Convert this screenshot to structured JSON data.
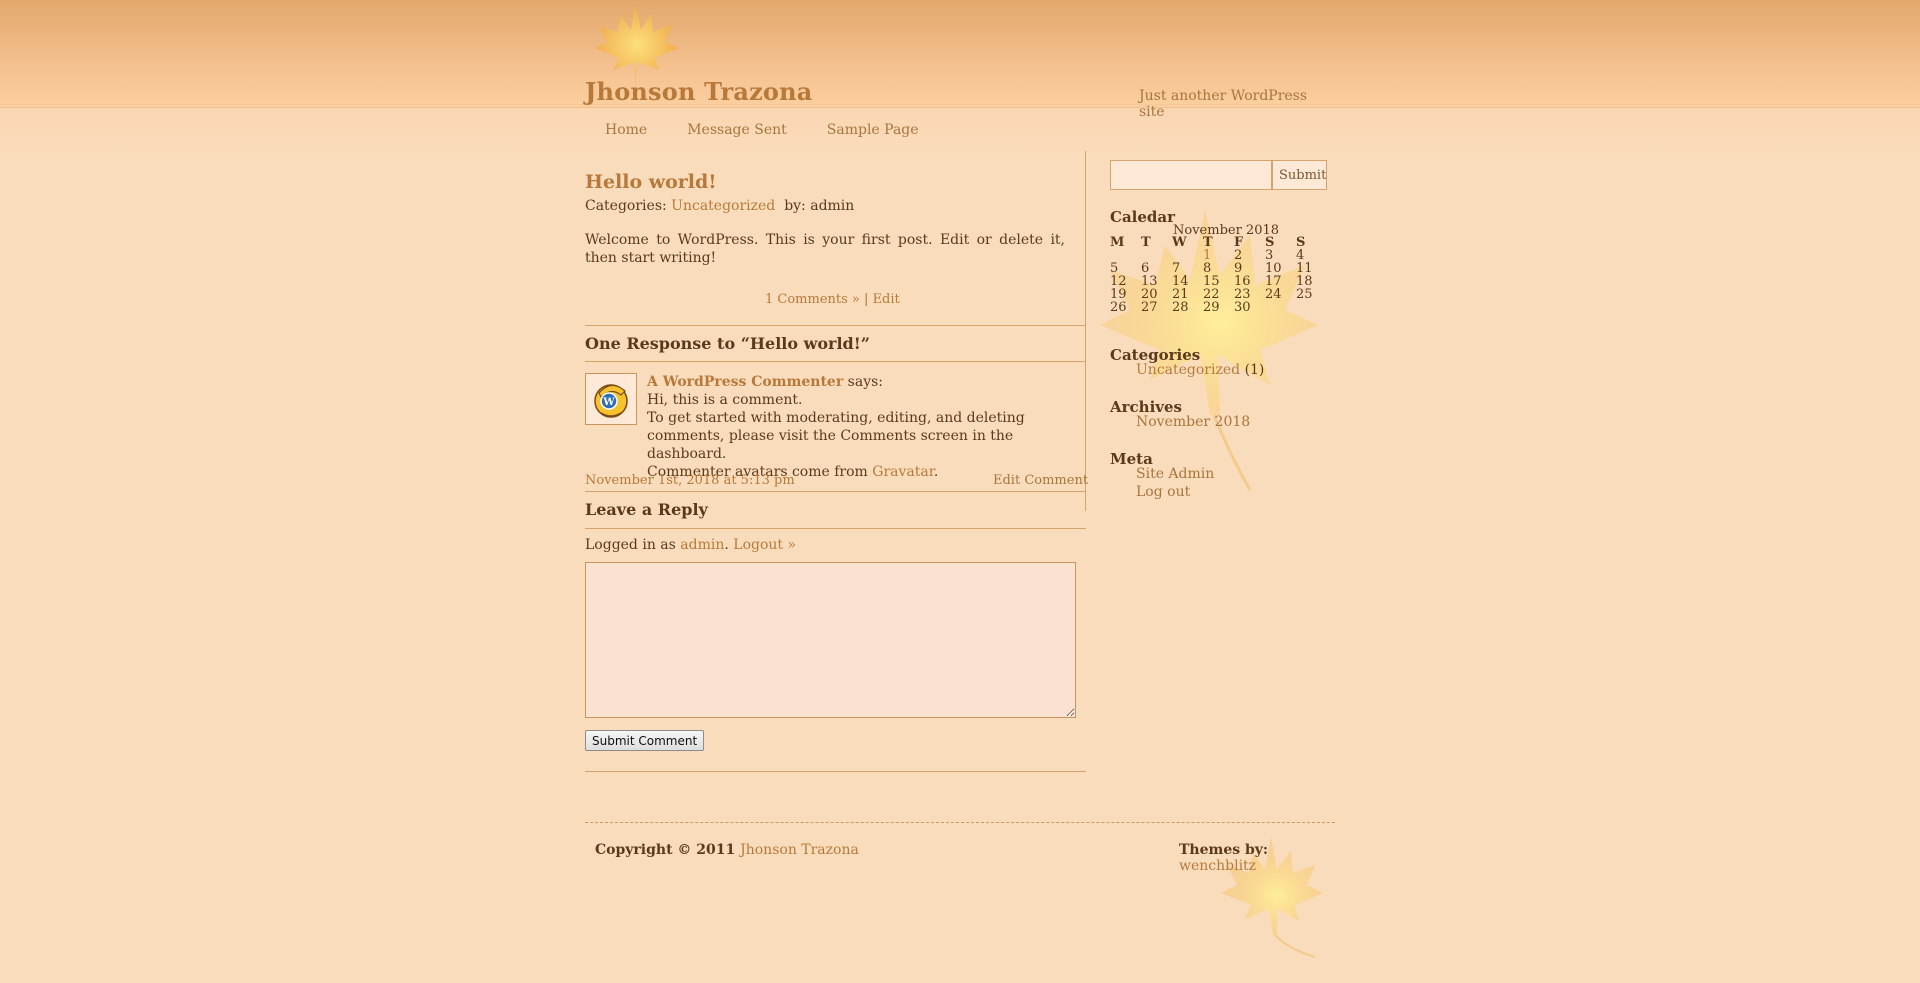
{
  "site": {
    "title": "Jhonson Trazona",
    "tagline": "Just another WordPress site"
  },
  "nav": [
    "Home",
    "Message Sent",
    "Sample Page"
  ],
  "post": {
    "title": "Hello world!",
    "categories_label": "Categories:",
    "category": "Uncategorized",
    "by_label": "by: admin",
    "body": "Welcome to WordPress. This is your first post. Edit or delete it, then start writing!",
    "comments_link": "1 Comments »",
    "separator": "|",
    "edit_link": "Edit"
  },
  "responses": {
    "title": "One Response to “Hello world!”",
    "comment": {
      "author": "A WordPress Commenter",
      "says": "says:",
      "line1": "Hi, this is a comment.",
      "line2": "To get started with moderating, editing, and deleting comments, please visit the Comments screen in the dashboard.",
      "line3_prefix": "Commenter avatars come from",
      "line3_link": "Gravatar",
      "line3_suffix": ".",
      "date": "November 1st, 2018 at 5:13 pm",
      "edit": "Edit Comment"
    }
  },
  "reply": {
    "title": "Leave a Reply",
    "logged_prefix": "Logged in as",
    "user": "admin",
    "logout": "Logout »",
    "textarea_value": "",
    "submit": "Submit Comment"
  },
  "sidebar": {
    "search_value": "",
    "search_button": "Submit",
    "calendar": {
      "heading": "Caledar",
      "caption": "November 2018",
      "days": [
        "M",
        "T",
        "W",
        "T",
        "F",
        "S",
        "S"
      ],
      "weeks": [
        [
          "",
          "",
          "",
          "1",
          "2",
          "3",
          "4"
        ],
        [
          "5",
          "6",
          "7",
          "8",
          "9",
          "10",
          "11"
        ],
        [
          "12",
          "13",
          "14",
          "15",
          "16",
          "17",
          "18"
        ],
        [
          "19",
          "20",
          "21",
          "22",
          "23",
          "24",
          "25"
        ],
        [
          "26",
          "27",
          "28",
          "29",
          "30",
          "",
          ""
        ]
      ],
      "linked_day": "1"
    },
    "categories": {
      "heading": "Categories",
      "item": "Uncategorized",
      "count": "(1)"
    },
    "archives": {
      "heading": "Archives",
      "item": "November 2018"
    },
    "meta": {
      "heading": "Meta",
      "items": [
        "Site Admin",
        "Log out"
      ]
    }
  },
  "footer": {
    "copyright": "Copyright © 2011",
    "copyright_link": "Jhonson Trazona",
    "themes_label": "Themes by:",
    "themes_link": "wenchblitz"
  },
  "colors": {
    "background": "#f9dcbb",
    "header_top": "#e3a86c",
    "accent_link": "#b8783a",
    "text": "#5a3a1a",
    "rule": "#d7a36c"
  }
}
